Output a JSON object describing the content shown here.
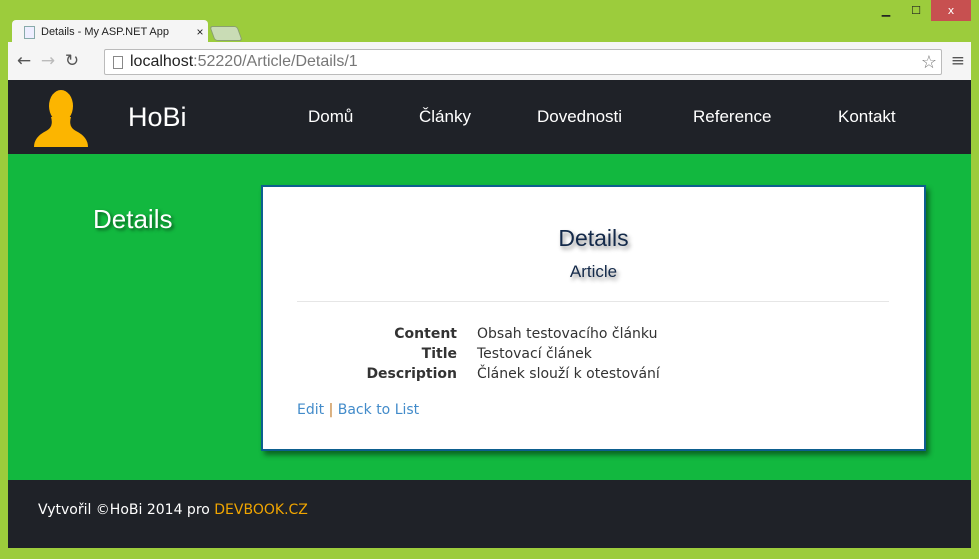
{
  "window": {
    "minimize": "▁",
    "maximize": "☐",
    "close": "x"
  },
  "tab": {
    "title": "Details - My ASP.NET App",
    "close": "×"
  },
  "toolbar": {
    "url_host": "localhost",
    "url_rest": ":52220/Article/Details/1"
  },
  "nav": {
    "brand": "HoBi",
    "links": [
      "Domů",
      "Články",
      "Dovednosti",
      "Reference",
      "Kontakt"
    ]
  },
  "colors": {
    "frame": "#9ccc3c",
    "nav": "#1f2228",
    "main": "#12b83f",
    "accent": "#f0a500",
    "link": "#428bca"
  },
  "sidebar": {
    "title": "Details"
  },
  "card": {
    "heading": "Details",
    "subheading": "Article",
    "fields": [
      {
        "label": "Content",
        "value": "Obsah testovacího článku"
      },
      {
        "label": "Title",
        "value": "Testovací článek"
      },
      {
        "label": "Description",
        "value": "Článek slouží k otestování"
      }
    ],
    "edit": "Edit",
    "separator": "|",
    "back": "Back to List"
  },
  "footer": {
    "text": "Vytvořil ©HoBi 2014 pro ",
    "link": "DEVBOOK.CZ"
  }
}
